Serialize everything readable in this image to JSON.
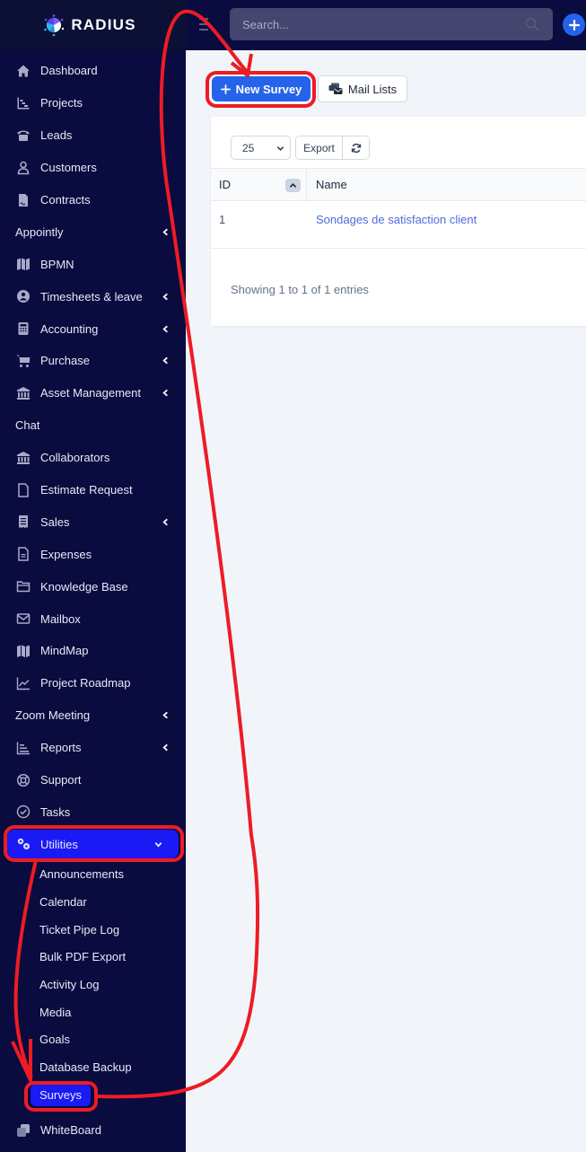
{
  "brand": {
    "name": "RADIUS",
    "logo_icon": "radius-logo-icon"
  },
  "topbar": {
    "menu_icon": "hamburger-icon",
    "search_placeholder": "Search...",
    "search_icon": "search-icon",
    "quick_add_icon": "plus-icon"
  },
  "sidebar": {
    "items": [
      {
        "label": "Dashboard",
        "icon": "home-icon"
      },
      {
        "label": "Projects",
        "icon": "chart-steps-icon"
      },
      {
        "label": "Leads",
        "icon": "phone-icon"
      },
      {
        "label": "Customers",
        "icon": "user-icon"
      },
      {
        "label": "Contracts",
        "icon": "file-contract-icon"
      },
      {
        "label": "Appointly",
        "icon": null,
        "submenu": true
      },
      {
        "label": "BPMN",
        "icon": "map-icon"
      },
      {
        "label": "Timesheets & leave",
        "icon": "user-circle-icon",
        "submenu": true
      },
      {
        "label": "Accounting",
        "icon": "calculator-icon",
        "submenu": true
      },
      {
        "label": "Purchase",
        "icon": "cart-icon",
        "submenu": true
      },
      {
        "label": "Asset Management",
        "icon": "bank-icon",
        "submenu": true
      },
      {
        "label": "Chat",
        "icon": null
      },
      {
        "label": "Collaborators",
        "icon": "bank-icon"
      },
      {
        "label": "Estimate Request",
        "icon": "file-icon"
      },
      {
        "label": "Sales",
        "icon": "receipt-icon",
        "submenu": true
      },
      {
        "label": "Expenses",
        "icon": "file-lines-icon"
      },
      {
        "label": "Knowledge Base",
        "icon": "folder-icon"
      },
      {
        "label": "Mailbox",
        "icon": "envelope-icon"
      },
      {
        "label": "MindMap",
        "icon": "map-icon"
      },
      {
        "label": "Project Roadmap",
        "icon": "line-chart-icon"
      },
      {
        "label": "Zoom Meeting",
        "icon": null,
        "submenu": true
      },
      {
        "label": "Reports",
        "icon": "bar-chart-icon",
        "submenu": true
      },
      {
        "label": "Support",
        "icon": "life-ring-icon"
      },
      {
        "label": "Tasks",
        "icon": "check-circle-icon"
      }
    ],
    "utilities": {
      "label": "Utilities",
      "icon": "cogs-icon",
      "expanded": true,
      "children": [
        "Announcements",
        "Calendar",
        "Ticket Pipe Log",
        "Bulk PDF Export",
        "Activity Log",
        "Media",
        "Goals",
        "Database Backup",
        "Surveys"
      ],
      "active_child": "Surveys"
    },
    "after": [
      {
        "label": "WhiteBoard",
        "icon": "clone-icon"
      }
    ]
  },
  "toolbar": {
    "new_survey_label": "New Survey",
    "mail_lists_label": "Mail Lists"
  },
  "table": {
    "page_length": "25",
    "export_label": "Export",
    "columns": [
      "ID",
      "Name"
    ],
    "sort_column": "ID",
    "sort_direction": "asc",
    "rows": [
      {
        "id": "1",
        "name": "Sondages de satisfaction client"
      }
    ],
    "info": "Showing 1 to 1 of 1 entries"
  },
  "colors": {
    "sidebar_bg": "#0a0b3f",
    "active_bg": "#1a1af5",
    "primary": "#2563eb",
    "link": "#4f6bdc",
    "annotation": "#ed1c24"
  }
}
